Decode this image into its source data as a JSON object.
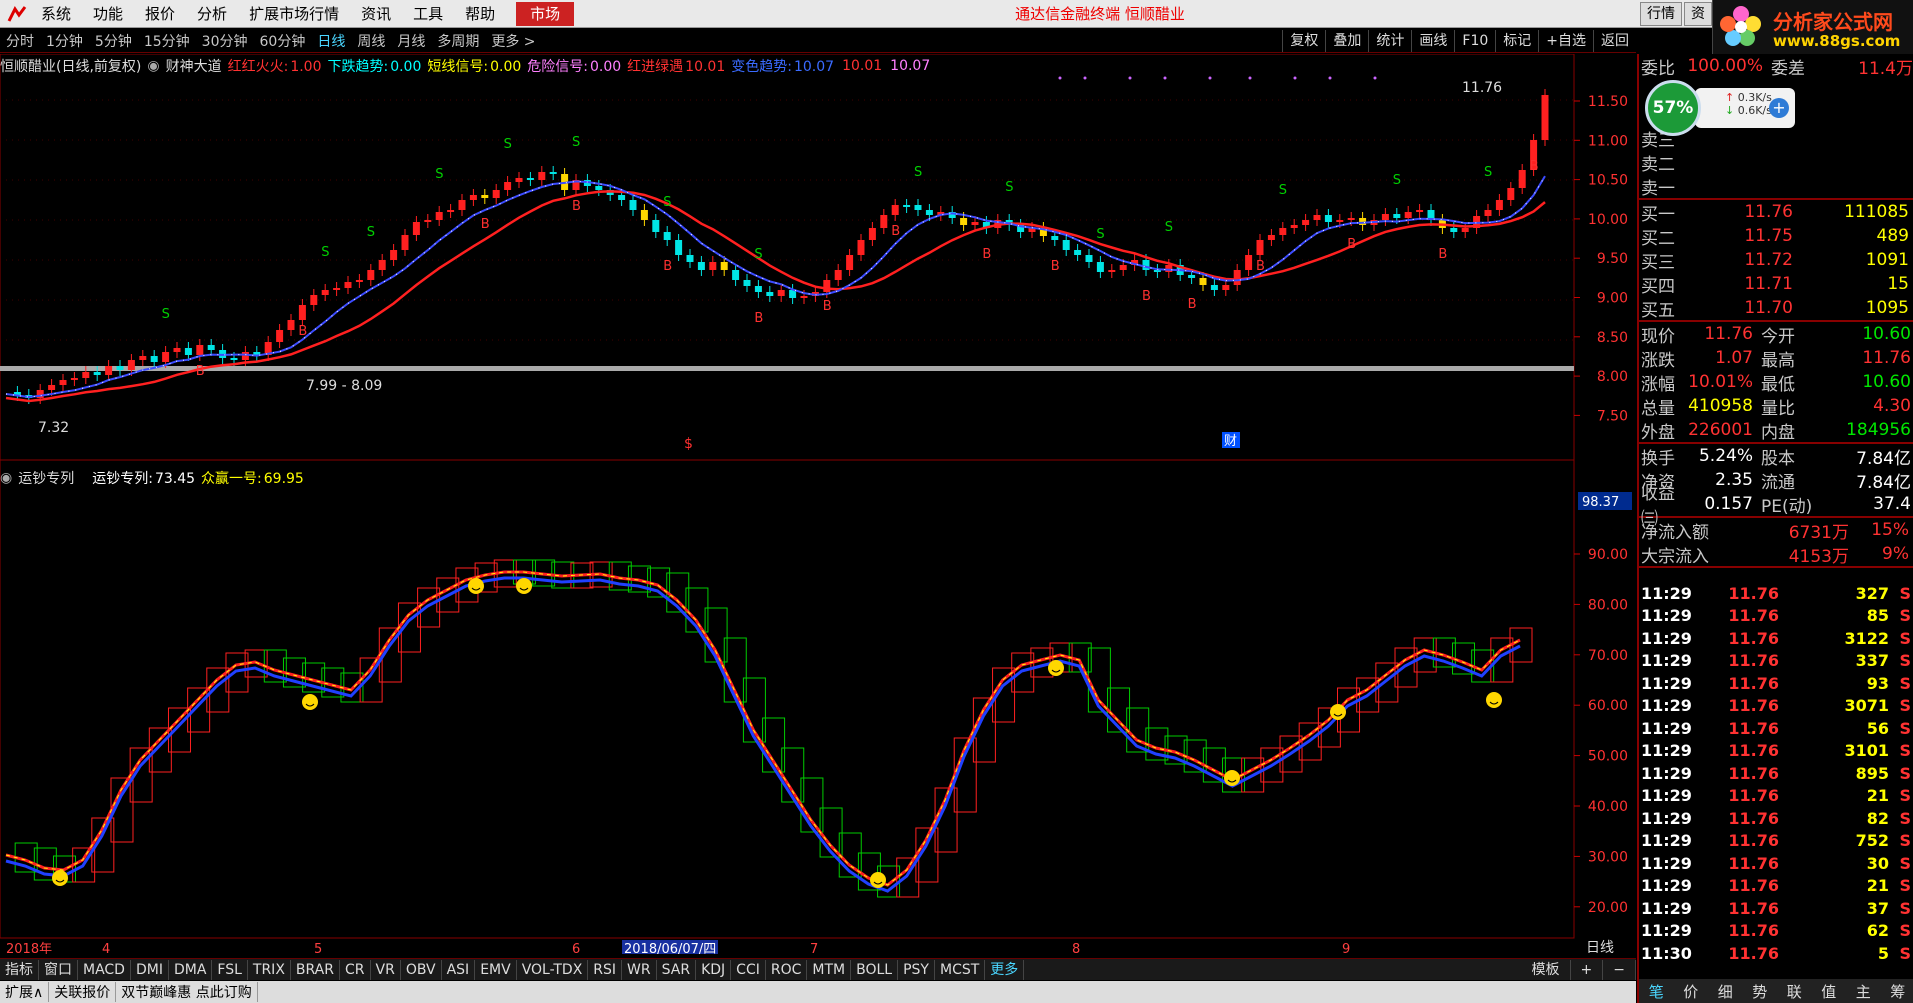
{
  "menu": {
    "items": [
      "系统",
      "功能",
      "报价",
      "分析",
      "扩展市场行情",
      "资讯",
      "工具",
      "帮助"
    ],
    "market": "市场",
    "title": "通达信金融终端  恒顺醋业",
    "window_tabs": [
      "行情",
      "资"
    ]
  },
  "brand": {
    "name": "分析家公式网",
    "url": "www.88gs.com"
  },
  "periods": [
    "分时",
    "1分钟",
    "5分钟",
    "15分钟",
    "30分钟",
    "60分钟",
    "日线",
    "周线",
    "月线",
    "多周期",
    "更多 >"
  ],
  "active_period": "日线",
  "tools": [
    "复权",
    "叠加",
    "统计",
    "画线",
    "F10",
    "标记",
    "+自选",
    "返回"
  ],
  "main_indicator": {
    "name": "恒顺醋业(日线,前复权)",
    "formula": "财神大道",
    "items": [
      {
        "label": "红红火火:",
        "value": "1.00",
        "color": "#ff3232"
      },
      {
        "label": "下跌趋势:",
        "value": "0.00",
        "color": "#00ffff"
      },
      {
        "label": "短线信号:",
        "value": "0.00",
        "color": "#ffff00"
      },
      {
        "label": "危险信号:",
        "value": "0.00",
        "color": "#ff80ff"
      },
      {
        "label": "红进绿遇",
        "value": "10.01",
        "color": "#ff3232"
      },
      {
        "label": "变色趋势:",
        "value": "10.07",
        "color": "#3a6bff"
      },
      {
        "label": "",
        "value": "10.01",
        "color": "#ff3232"
      },
      {
        "label": "",
        "value": "10.07",
        "color": "#ff80ff"
      }
    ]
  },
  "sub_indicator": {
    "name": "运钞专列",
    "items": [
      {
        "label": "运钞专列:",
        "value": "73.45",
        "color": "#ffffff"
      },
      {
        "label": "众赢一号:",
        "value": "69.95",
        "color": "#ffff00"
      }
    ]
  },
  "price_axis": [
    "11.50",
    "11.00",
    "10.50",
    "10.00",
    "9.50",
    "9.00",
    "8.50",
    "8.00",
    "7.50"
  ],
  "sub_axis": [
    "90.00",
    "80.00",
    "70.00",
    "60.00",
    "50.00",
    "40.00",
    "30.00",
    "20.00"
  ],
  "sub_axis_current": "98.37",
  "annotations": {
    "high": "11.76",
    "low": "7.32",
    "range": "7.99 - 8.09",
    "sig_s": "S",
    "sig_b": "B",
    "cai": "财",
    "dollar": "$"
  },
  "date_axis": [
    "2018年",
    "4",
    "5",
    "6",
    "2018/06/07/四",
    "7",
    "8",
    "9"
  ],
  "date_mode": "日线",
  "indicator_tabs": [
    "指标",
    "窗口",
    "MACD",
    "DMI",
    "DMA",
    "FSL",
    "TRIX",
    "BRAR",
    "CR",
    "VR",
    "OBV",
    "ASI",
    "EMV",
    "VOL-TDX",
    "RSI",
    "WR",
    "SAR",
    "KDJ",
    "CCI",
    "ROC",
    "MTM",
    "BOLL",
    "PSY",
    "MCST",
    "更多"
  ],
  "template_btns": [
    "模板",
    "+",
    "−"
  ],
  "status_items": [
    "扩展∧",
    "关联报价",
    "双节巅峰惠 点此订购"
  ],
  "speed": {
    "pct": "57%",
    "up": "0.3K/s",
    "down": "0.6K/s"
  },
  "quote": {
    "weibi_label": "委比",
    "weibi": "100.00%",
    "weicha_label": "委差",
    "weicha": "11.4万",
    "sell": [
      {
        "label": "卖三"
      },
      {
        "label": "卖二"
      },
      {
        "label": "卖一"
      }
    ],
    "buy": [
      {
        "label": "买一",
        "price": "11.76",
        "vol": "111085"
      },
      {
        "label": "买二",
        "price": "11.75",
        "vol": "489"
      },
      {
        "label": "买三",
        "price": "11.72",
        "vol": "1091"
      },
      {
        "label": "买四",
        "price": "11.71",
        "vol": "15"
      },
      {
        "label": "买五",
        "price": "11.70",
        "vol": "1095"
      }
    ],
    "stats": [
      {
        "l1": "现价",
        "v1": "11.76",
        "c1": "red",
        "l2": "今开",
        "v2": "10.60",
        "c2": "green"
      },
      {
        "l1": "涨跌",
        "v1": "1.07",
        "c1": "red",
        "l2": "最高",
        "v2": "11.76",
        "c2": "red"
      },
      {
        "l1": "涨幅",
        "v1": "10.01%",
        "c1": "red",
        "l2": "最低",
        "v2": "10.60",
        "c2": "green"
      },
      {
        "l1": "总量",
        "v1": "410958",
        "c1": "yellow",
        "l2": "量比",
        "v2": "4.30",
        "c2": "red"
      },
      {
        "l1": "外盘",
        "v1": "226001",
        "c1": "red",
        "l2": "内盘",
        "v2": "184956",
        "c2": "green"
      }
    ],
    "stats2": [
      {
        "l1": "换手",
        "v1": "5.24%",
        "l2": "股本",
        "v2": "7.84亿"
      },
      {
        "l1": "净资",
        "v1": "2.35",
        "l2": "流通",
        "v2": "7.84亿"
      },
      {
        "l1": "收益㈢",
        "v1": "0.157",
        "l2": "PE(动)",
        "v2": "37.4"
      }
    ],
    "flows": [
      {
        "label": "净流入额",
        "value": "6731万",
        "pct": "15%"
      },
      {
        "label": "大宗流入",
        "value": "4153万",
        "pct": "9%"
      }
    ]
  },
  "ticks": [
    {
      "t": "11:29",
      "p": "11.76",
      "v": "327",
      "c": "yellow",
      "s": "S"
    },
    {
      "t": "11:29",
      "p": "11.76",
      "v": "85",
      "c": "yellow",
      "s": "S"
    },
    {
      "t": "11:29",
      "p": "11.76",
      "v": "3122",
      "c": "magenta",
      "s": "S"
    },
    {
      "t": "11:29",
      "p": "11.76",
      "v": "337",
      "c": "yellow",
      "s": "S"
    },
    {
      "t": "11:29",
      "p": "11.76",
      "v": "93",
      "c": "yellow",
      "s": "S"
    },
    {
      "t": "11:29",
      "p": "11.76",
      "v": "3071",
      "c": "magenta",
      "s": "S"
    },
    {
      "t": "11:29",
      "p": "11.76",
      "v": "56",
      "c": "yellow",
      "s": "S"
    },
    {
      "t": "11:29",
      "p": "11.76",
      "v": "3101",
      "c": "magenta",
      "s": "S"
    },
    {
      "t": "11:29",
      "p": "11.76",
      "v": "895",
      "c": "magenta",
      "s": "S"
    },
    {
      "t": "11:29",
      "p": "11.76",
      "v": "21",
      "c": "yellow",
      "s": "S"
    },
    {
      "t": "11:29",
      "p": "11.76",
      "v": "82",
      "c": "yellow",
      "s": "S"
    },
    {
      "t": "11:29",
      "p": "11.76",
      "v": "752",
      "c": "magenta",
      "s": "S"
    },
    {
      "t": "11:29",
      "p": "11.76",
      "v": "30",
      "c": "yellow",
      "s": "S"
    },
    {
      "t": "11:29",
      "p": "11.76",
      "v": "21",
      "c": "yellow",
      "s": "S"
    },
    {
      "t": "11:29",
      "p": "11.76",
      "v": "37",
      "c": "yellow",
      "s": "S"
    },
    {
      "t": "11:29",
      "p": "11.76",
      "v": "62",
      "c": "yellow",
      "s": "S"
    },
    {
      "t": "11:30",
      "p": "11.76",
      "v": "5",
      "c": "yellow",
      "s": "S"
    }
  ],
  "panel_tabs": [
    "笔",
    "价",
    "细",
    "势",
    "联",
    "值",
    "主",
    "筹"
  ]
}
